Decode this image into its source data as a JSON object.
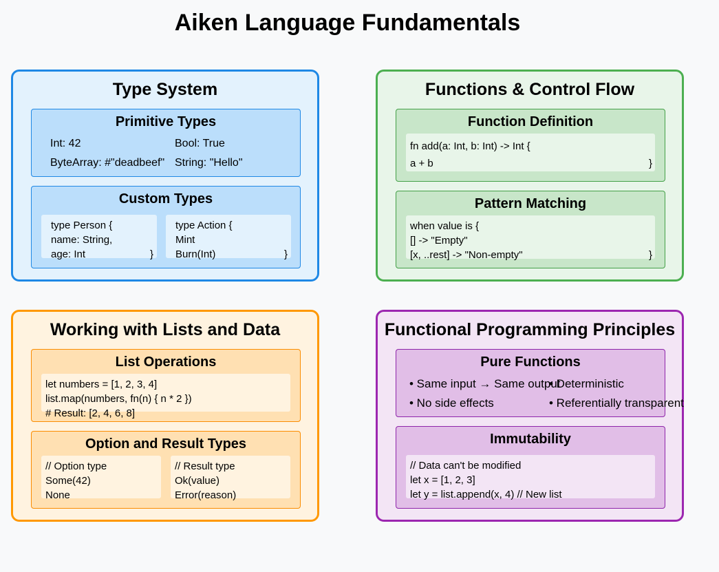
{
  "title": "Aiken Language Fundamentals",
  "type_system": {
    "title": "Type System",
    "primitive": {
      "title": "Primitive Types",
      "int": "Int: 42",
      "bool": "Bool: True",
      "bytearray": "ByteArray: #\"deadbeef\"",
      "string": "String: \"Hello\""
    },
    "custom": {
      "title": "Custom Types",
      "person": [
        "type Person {",
        "name: String,",
        "age: Int",
        "}"
      ],
      "action": [
        "type Action {",
        "Mint",
        "Burn(Int)",
        "}"
      ]
    }
  },
  "functions": {
    "title": "Functions & Control Flow",
    "definition": {
      "title": "Function Definition",
      "lines": [
        "fn add(a: Int, b: Int) -> Int {",
        "a + b",
        "}"
      ]
    },
    "pattern": {
      "title": "Pattern Matching",
      "lines": [
        "when value is {",
        "[] -> \"Empty\"",
        "[x, ..rest] -> \"Non-empty\"",
        "}"
      ]
    }
  },
  "lists": {
    "title": "Working with Lists and Data",
    "operations": {
      "title": "List Operations",
      "lines": [
        "let numbers = [1, 2, 3, 4]",
        "list.map(numbers, fn(n) { n * 2 })",
        "# Result: [2, 4, 6, 8]"
      ]
    },
    "option_result": {
      "title": "Option and Result Types",
      "option": [
        "// Option type",
        "Some(42)",
        "None"
      ],
      "result": [
        "// Result type",
        "Ok(value)",
        "Error(reason)"
      ]
    }
  },
  "fp": {
    "title": "Functional Programming Principles",
    "pure": {
      "title": "Pure Functions",
      "b1": "• Same input → Same output",
      "b2": "• Deterministic",
      "b3": "• No side effects",
      "b4": "• Referentially transparent"
    },
    "immutability": {
      "title": "Immutability",
      "lines": [
        "// Data can't be modified",
        "let x = [1, 2, 3]",
        "let y = list.append(x, 4) // New list"
      ]
    }
  }
}
